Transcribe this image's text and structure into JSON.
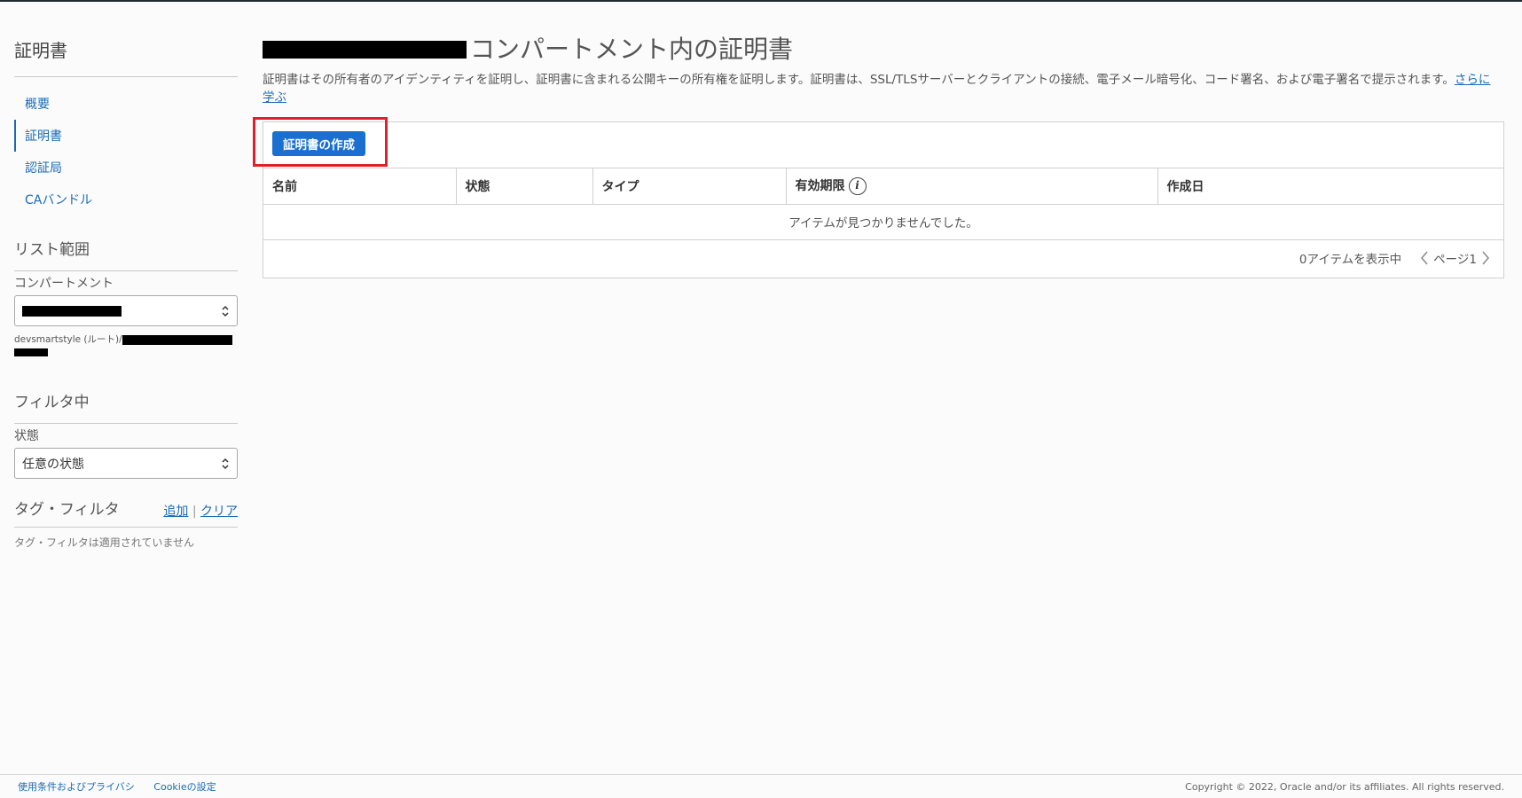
{
  "sidebar": {
    "title": "証明書",
    "nav": [
      {
        "label": "概要"
      },
      {
        "label": "証明書"
      },
      {
        "label": "認証局"
      },
      {
        "label": "CAバンドル"
      }
    ],
    "list_scope": {
      "heading": "リスト範囲",
      "compartment_label": "コンパートメント",
      "compartment_path_prefix": "devsmartstyle (ルート)/"
    },
    "filters": {
      "heading": "フィルタ中",
      "state_label": "状態",
      "state_value": "任意の状態"
    },
    "tag_filter": {
      "heading": "タグ・フィルタ",
      "add": "追加",
      "separator": "|",
      "clear": "クリア",
      "note": "タグ・フィルタは適用されていません"
    }
  },
  "main": {
    "title_suffix": "コンパートメント内の証明書",
    "description": "証明書はその所有者のアイデンティティを証明し、証明書に含まれる公開キーの所有権を証明します。証明書は、SSL/TLSサーバーとクライアントの接続、電子メール暗号化、コード署名、および電子署名で提示されます。",
    "learn_more": "さらに学ぶ",
    "create_button": "証明書の作成",
    "table": {
      "columns": [
        "名前",
        "状態",
        "タイプ",
        "有効期限",
        "作成日"
      ],
      "empty_message": "アイテムが見つかりませんでした。"
    },
    "pager": {
      "showing": "0アイテムを表示中",
      "page": "ページ1"
    }
  },
  "footer": {
    "terms": "使用条件およびプライバシ",
    "cookies": "Cookieの設定",
    "copyright": "Copyright © 2022, Oracle and/or its affiliates. All rights reserved."
  },
  "colors": {
    "accent": "#1b6fd0",
    "link": "#1a6bb5",
    "highlight": "#e0202a"
  }
}
